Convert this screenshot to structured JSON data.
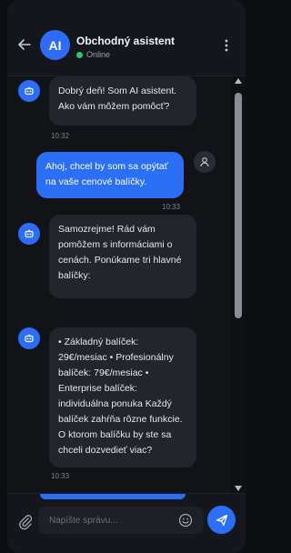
{
  "header": {
    "title": "Obchodný asistent",
    "status": "Online",
    "avatar_text": "AI"
  },
  "messages": [
    {
      "role": "bot",
      "text": "Dobrý deň! Som AI asistent. Ako vám môžem pomôcť?",
      "time": "10:32"
    },
    {
      "role": "user",
      "text": "Ahoj, chcel by som sa opýtať na vaše cenové balíčky.",
      "time": "10:33"
    },
    {
      "role": "bot",
      "text": "Samozrejme! Rád vám pomôžem s informáciami o cenách. Ponúkame tri hlavné balíčky:",
      "time": ""
    },
    {
      "role": "bot",
      "text": "• Základný balíček: 29€/mesiac • Profesionálny balíček: 79€/mesiac • Enterprise balíček: individuálna ponuka Každý balíček zahŕňa rôzne funkcie. O ktorom balíčku by ste sa chceli dozvedieť viac?",
      "time": "10:33"
    }
  ],
  "composer": {
    "placeholder": "Napíšte správu..."
  },
  "icons": {
    "back": "arrow-left-icon",
    "more": "more-vertical-icon",
    "bot": "robot-icon",
    "user": "user-icon",
    "attach": "paperclip-icon",
    "emoji": "smiley-icon",
    "send": "send-icon"
  },
  "colors": {
    "accent": "#2b6ff7",
    "online": "#28c76f",
    "bot_bubble": "#23252c",
    "background": "#121317"
  }
}
